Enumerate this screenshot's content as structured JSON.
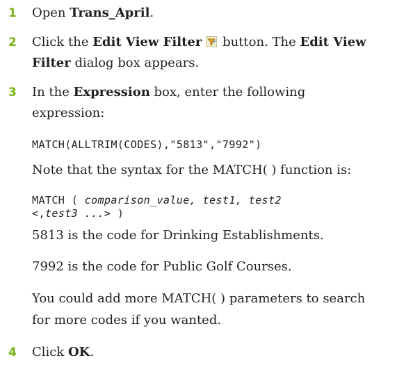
{
  "steps": [
    {
      "number": "1",
      "prefix": "Open ",
      "bold": "Trans_April",
      "suffix": "."
    },
    {
      "number": "2",
      "line1_prefix": "Click the ",
      "line1_bold1": "Edit View Filter",
      "line1_mid": " button. The ",
      "line1_bold2": "Edit View",
      "line2_bold": "Filter",
      "line2_suffix": " dialog box appears.",
      "icon": "edit-view-filter-icon"
    },
    {
      "number": "3",
      "line1_prefix": "In the ",
      "line1_bold": "Expression",
      "line1_suffix": " box, enter the following",
      "line2": "expression:",
      "code1": "MATCH(ALLTRIM(CODES),\"5813\",\"7992\")",
      "note": "Note that the syntax for the MATCH( ) function is:",
      "syntax_a": "MATCH (",
      "syntax_b": "comparison_value, test1, test2",
      "syntax_c": "<,",
      "syntax_d": "test3 ...",
      "syntax_e": "> )",
      "para1": "5813 is the code for Drinking Establishments.",
      "para2": "7992 is the code for Public Golf Courses.",
      "para3_line1": "You could add more MATCH( ) parameters to search",
      "para3_line2": "for more codes if you wanted."
    },
    {
      "number": "4",
      "prefix": "Click ",
      "bold": "OK",
      "suffix": "."
    }
  ],
  "colors": {
    "step_number": "#7ab317",
    "text": "#231f20"
  }
}
